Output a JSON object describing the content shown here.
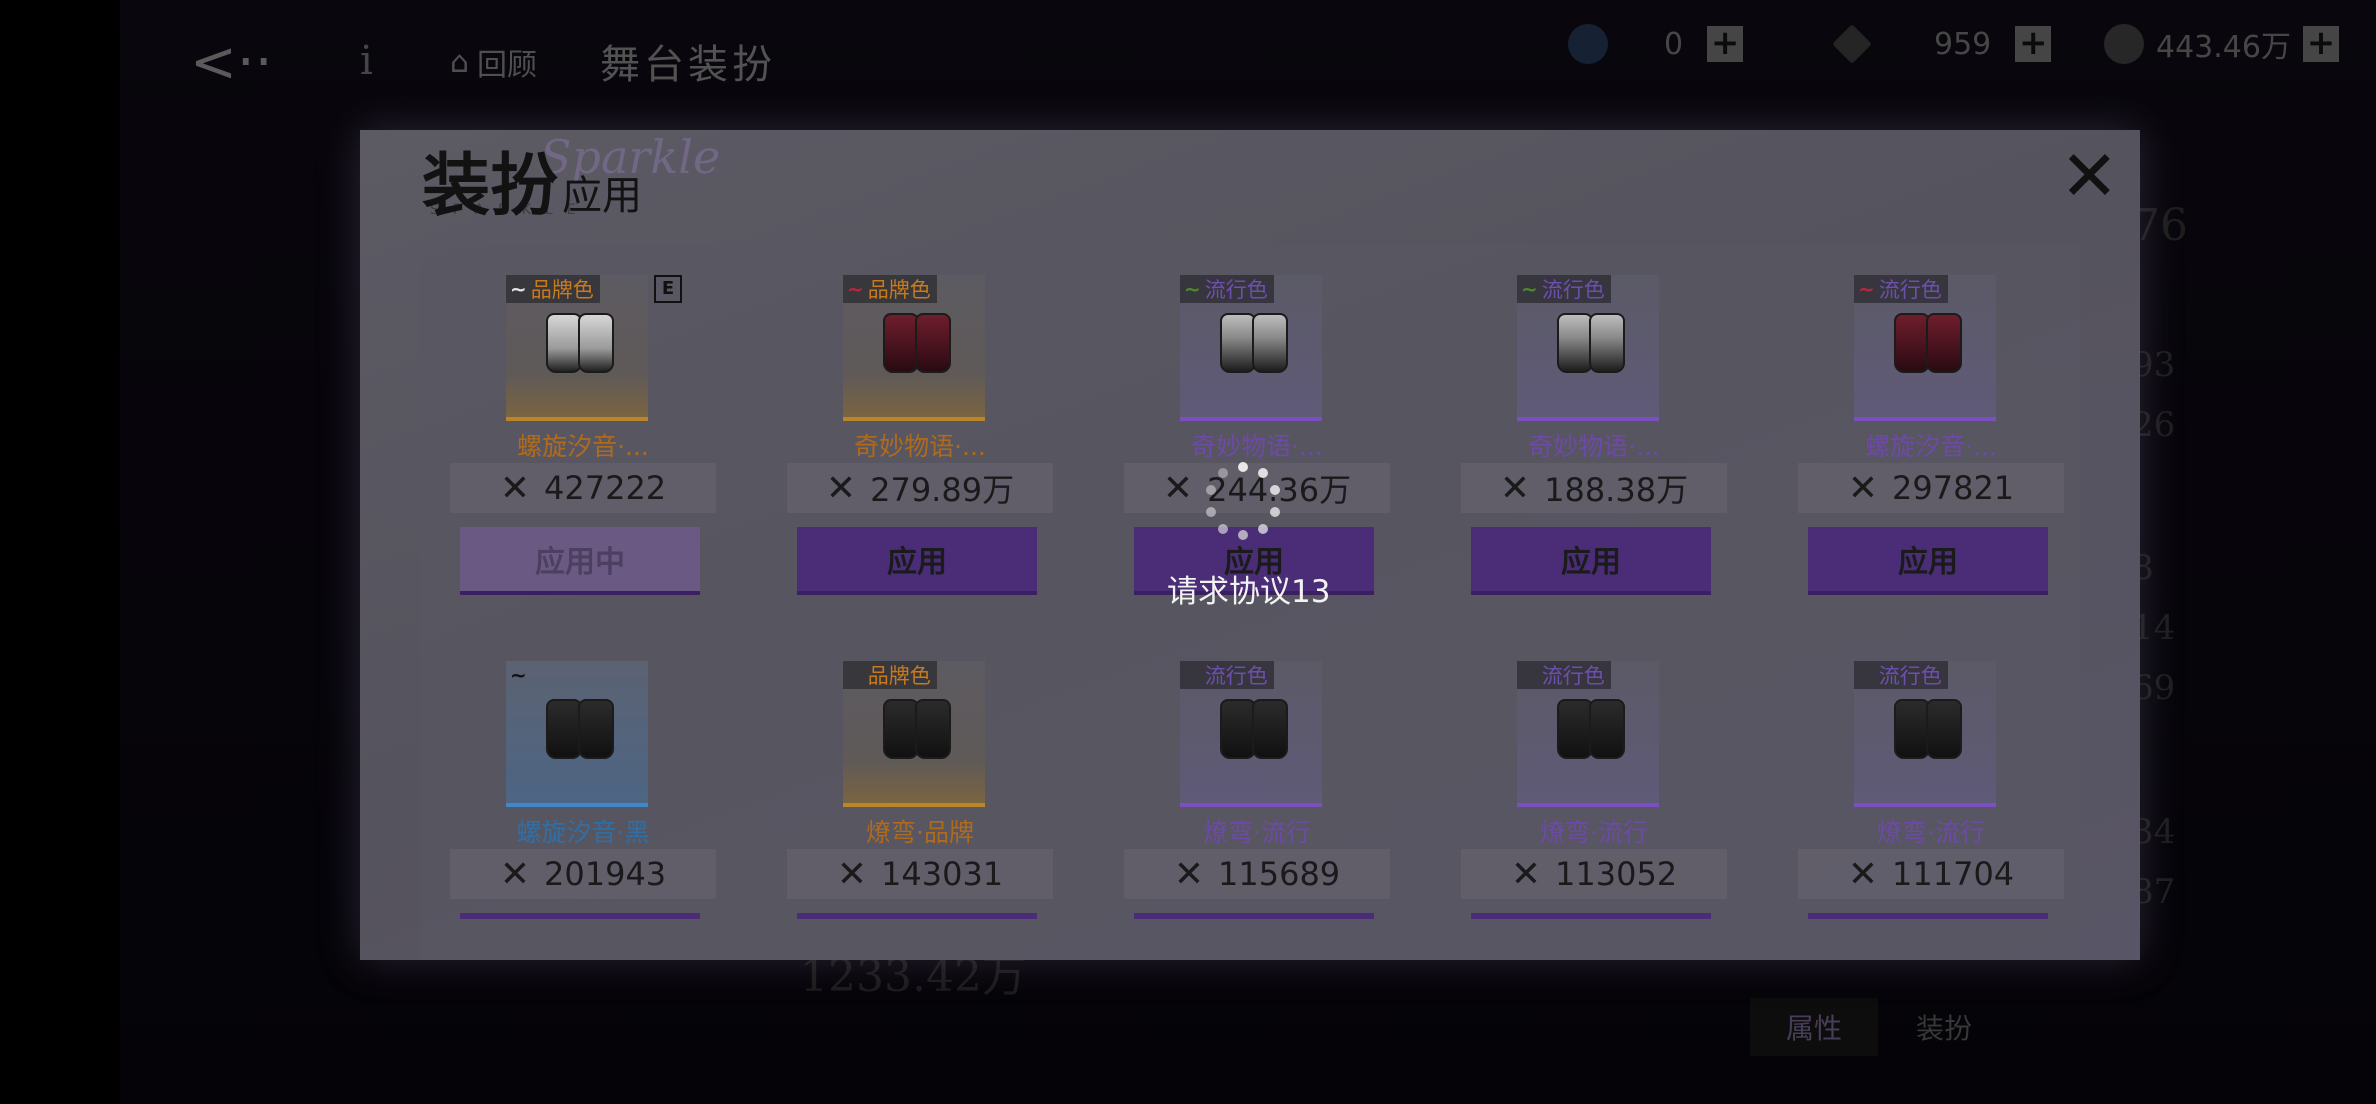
{
  "topbar": {
    "back_glyph": "<··",
    "info_glyph": "i",
    "home_label": "回顾",
    "page_title": "舞台装扮",
    "currencies": [
      {
        "icon": "diamond-blue-icon",
        "value": "0"
      },
      {
        "icon": "gem-white-icon",
        "value": "959"
      },
      {
        "icon": "coin-icon",
        "value": "443.46万"
      }
    ],
    "plus_glyph": "+"
  },
  "background": {
    "side_values": [
      "76",
      "93",
      "26",
      "8",
      "14",
      "69",
      "34",
      "87"
    ],
    "total_power": "1233.42万",
    "tab_attributes": "属性",
    "tab_outfit": "装扮"
  },
  "modal": {
    "title": "装扮",
    "title_sub": "应用",
    "deco_script": "Sparkle",
    "deco_caps": "SPARKLE",
    "close_glyph": "✕",
    "items": [
      {
        "tag": "品牌色",
        "tag_color": "#c77a1e",
        "wave_color": "#e2e2e2",
        "badge": "E",
        "name": "螺旋汐音·...",
        "name_color": "#b06a1c",
        "power": "427222",
        "button": "应用中",
        "button_state": "active",
        "frame": "orange",
        "shoe": "shoe-white"
      },
      {
        "tag": "品牌色",
        "tag_color": "#c77a1e",
        "wave_color": "#c0243c",
        "badge": "",
        "name": "奇妙物语·...",
        "name_color": "#b06a1c",
        "power": "279.89万",
        "button": "应用",
        "button_state": "normal",
        "frame": "orange",
        "shoe": "shoe-red"
      },
      {
        "tag": "流行色",
        "tag_color": "#6e4fb0",
        "wave_color": "#4e8a2a",
        "badge": "",
        "name": "奇妙物语·...",
        "name_color": "#6d4aa8",
        "power": "244.36万",
        "button": "应用",
        "button_state": "normal",
        "frame": "purple",
        "shoe": "shoe-mix"
      },
      {
        "tag": "流行色",
        "tag_color": "#6e4fb0",
        "wave_color": "#4e8a2a",
        "badge": "",
        "name": "奇妙物语·...",
        "name_color": "#6d4aa8",
        "power": "188.38万",
        "button": "应用",
        "button_state": "normal",
        "frame": "purple",
        "shoe": "shoe-mix"
      },
      {
        "tag": "流行色",
        "tag_color": "#6e4fb0",
        "wave_color": "#c0243c",
        "badge": "",
        "name": "螺旋汐音·...",
        "name_color": "#6d4aa8",
        "power": "297821",
        "button": "应用",
        "button_state": "normal",
        "frame": "purple",
        "shoe": "shoe-red"
      },
      {
        "tag": "",
        "tag_color": "#111111",
        "wave_color": "#111111",
        "badge": "",
        "name": "螺旋汐音·黑",
        "name_color": "#2f6fa6",
        "power": "201943",
        "button": "",
        "button_state": "bar",
        "frame": "blue",
        "shoe": "shoe-dark"
      },
      {
        "tag": "品牌色",
        "tag_color": "#c77a1e",
        "wave_color": "",
        "badge": "",
        "name": "燎弯·品牌",
        "name_color": "#b06a1c",
        "power": "143031",
        "button": "",
        "button_state": "bar",
        "frame": "orange",
        "shoe": "shoe-dark"
      },
      {
        "tag": "流行色",
        "tag_color": "#6e4fb0",
        "wave_color": "",
        "badge": "",
        "name": "燎弯·流行",
        "name_color": "#6d4aa8",
        "power": "115689",
        "button": "",
        "button_state": "bar",
        "frame": "purple",
        "shoe": "shoe-dark"
      },
      {
        "tag": "流行色",
        "tag_color": "#6e4fb0",
        "wave_color": "",
        "badge": "",
        "name": "燎弯·流行",
        "name_color": "#6d4aa8",
        "power": "113052",
        "button": "",
        "button_state": "bar",
        "frame": "purple",
        "shoe": "shoe-dark"
      },
      {
        "tag": "流行色",
        "tag_color": "#6e4fb0",
        "wave_color": "",
        "badge": "",
        "name": "燎弯·流行",
        "name_color": "#6d4aa8",
        "power": "111704",
        "button": "",
        "button_state": "bar",
        "frame": "purple",
        "shoe": "shoe-dark"
      }
    ]
  },
  "loading": {
    "text": "请求协议13"
  }
}
